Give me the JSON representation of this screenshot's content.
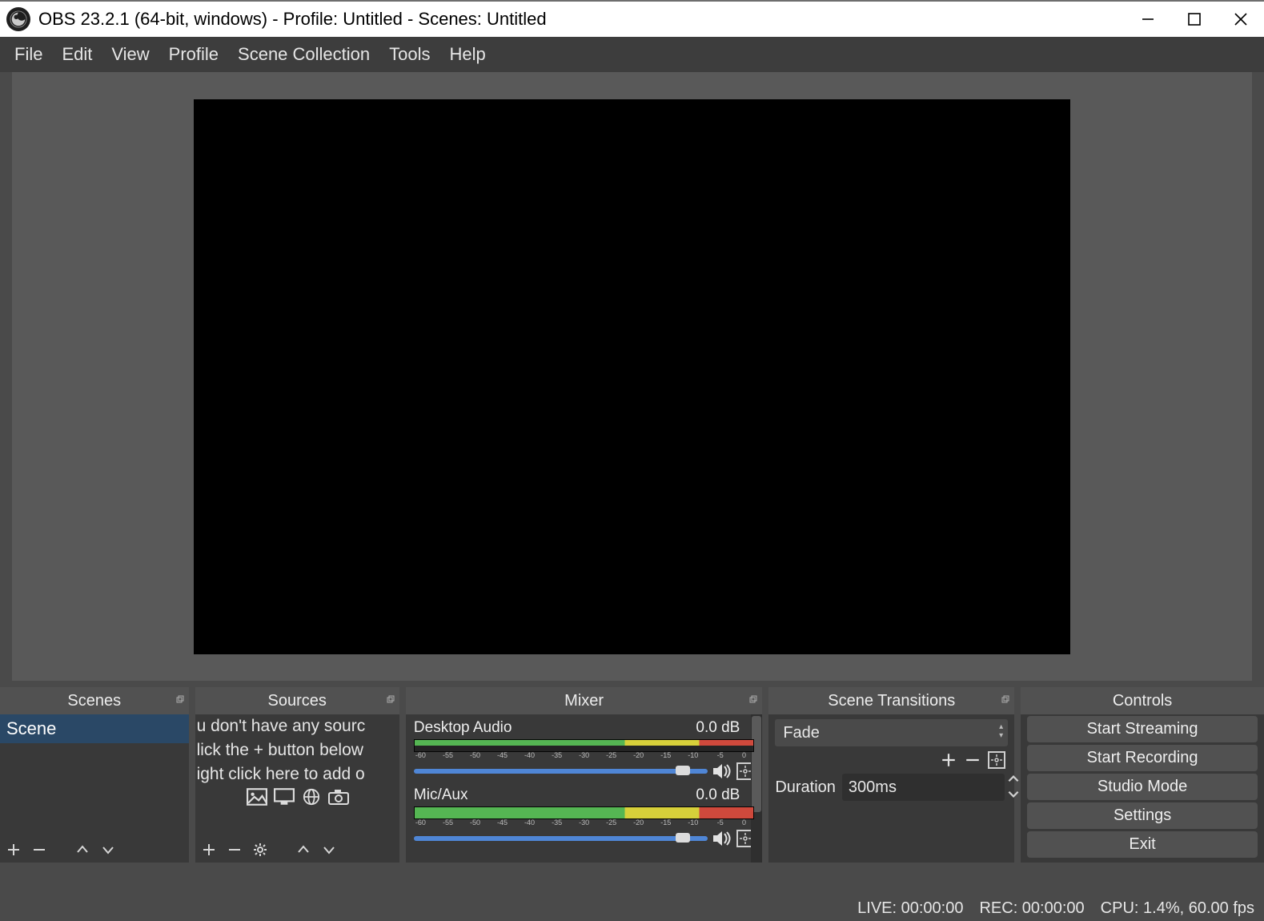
{
  "window": {
    "title": "OBS 23.2.1 (64-bit, windows) - Profile: Untitled - Scenes: Untitled"
  },
  "menu": {
    "items": [
      "File",
      "Edit",
      "View",
      "Profile",
      "Scene Collection",
      "Tools",
      "Help"
    ]
  },
  "panels": {
    "scenes_title": "Scenes",
    "sources_title": "Sources",
    "mixer_title": "Mixer",
    "transitions_title": "Scene Transitions",
    "controls_title": "Controls"
  },
  "scenes": {
    "items": [
      {
        "name": "Scene"
      }
    ]
  },
  "sources": {
    "placeholder_line1": "u don't have any sourc",
    "placeholder_line2": "lick the + button below",
    "placeholder_line3": "ight click here to add o"
  },
  "mixer": {
    "tracks": [
      {
        "name": "Desktop Audio",
        "db": "0.0 dB"
      },
      {
        "name": "Mic/Aux",
        "db": "0.0 dB"
      }
    ],
    "ticks": [
      "-60",
      "-55",
      "-50",
      "-45",
      "-40",
      "-35",
      "-30",
      "-25",
      "-20",
      "-15",
      "-10",
      "-5",
      "0"
    ]
  },
  "transitions": {
    "selected": "Fade",
    "duration_label": "Duration",
    "duration_value": "300ms"
  },
  "controls": {
    "buttons": [
      "Start Streaming",
      "Start Recording",
      "Studio Mode",
      "Settings",
      "Exit"
    ]
  },
  "status": {
    "live": "LIVE: 00:00:00",
    "rec": "REC: 00:00:00",
    "cpu": "CPU: 1.4%, 60.00 fps"
  }
}
